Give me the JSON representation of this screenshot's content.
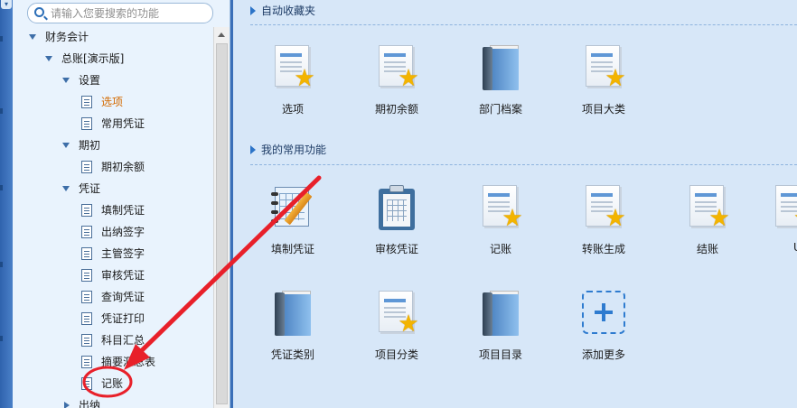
{
  "search": {
    "placeholder": "请输入您要搜索的功能"
  },
  "tree": {
    "items": [
      {
        "label": "财务会计",
        "level": 0,
        "kind": "folder-open"
      },
      {
        "label": "总账[演示版]",
        "level": 1,
        "kind": "folder-open"
      },
      {
        "label": "设置",
        "level": 2,
        "kind": "folder-open"
      },
      {
        "label": "选项",
        "level": 3,
        "kind": "leaf",
        "active": true
      },
      {
        "label": "常用凭证",
        "level": 3,
        "kind": "leaf"
      },
      {
        "label": "期初",
        "level": 2,
        "kind": "folder-open"
      },
      {
        "label": "期初余额",
        "level": 3,
        "kind": "leaf"
      },
      {
        "label": "凭证",
        "level": 2,
        "kind": "folder-open"
      },
      {
        "label": "填制凭证",
        "level": 3,
        "kind": "leaf"
      },
      {
        "label": "出纳签字",
        "level": 3,
        "kind": "leaf"
      },
      {
        "label": "主管签字",
        "level": 3,
        "kind": "leaf"
      },
      {
        "label": "审核凭证",
        "level": 3,
        "kind": "leaf"
      },
      {
        "label": "查询凭证",
        "level": 3,
        "kind": "leaf"
      },
      {
        "label": "凭证打印",
        "level": 3,
        "kind": "leaf"
      },
      {
        "label": "科目汇总",
        "level": 3,
        "kind": "leaf"
      },
      {
        "label": "摘要汇总表",
        "level": 3,
        "kind": "leaf"
      },
      {
        "label": "记账",
        "level": 3,
        "kind": "leaf"
      },
      {
        "label": "出纳",
        "level": 2,
        "kind": "folder-closed"
      }
    ]
  },
  "main": {
    "favorites": {
      "title": "自动收藏夹",
      "tiles": [
        {
          "label": "选项",
          "icon": "doc-star-icon"
        },
        {
          "label": "期初余额",
          "icon": "doc-star-icon"
        },
        {
          "label": "部门档案",
          "icon": "binder-icon"
        },
        {
          "label": "项目大类",
          "icon": "doc-star-icon"
        }
      ]
    },
    "common": {
      "title": "我的常用功能",
      "tiles": [
        {
          "label": "填制凭证",
          "icon": "fill-voucher-icon"
        },
        {
          "label": "审核凭证",
          "icon": "clipboard-icon"
        },
        {
          "label": "记账",
          "icon": "doc-star-icon"
        },
        {
          "label": "转账生成",
          "icon": "doc-star-icon"
        },
        {
          "label": "结账",
          "icon": "doc-star-icon"
        },
        {
          "label": "U",
          "icon": "doc-star-icon"
        },
        {
          "label": "凭证类别",
          "icon": "binder-icon"
        },
        {
          "label": "项目分类",
          "icon": "doc-star-icon"
        },
        {
          "label": "项目目录",
          "icon": "binder-icon"
        },
        {
          "label": "添加更多",
          "icon": "add-icon"
        }
      ]
    }
  },
  "colors": {
    "active_item": "#d46a00",
    "annotation_red": "#e8202a",
    "accent_blue": "#2c74c8"
  }
}
